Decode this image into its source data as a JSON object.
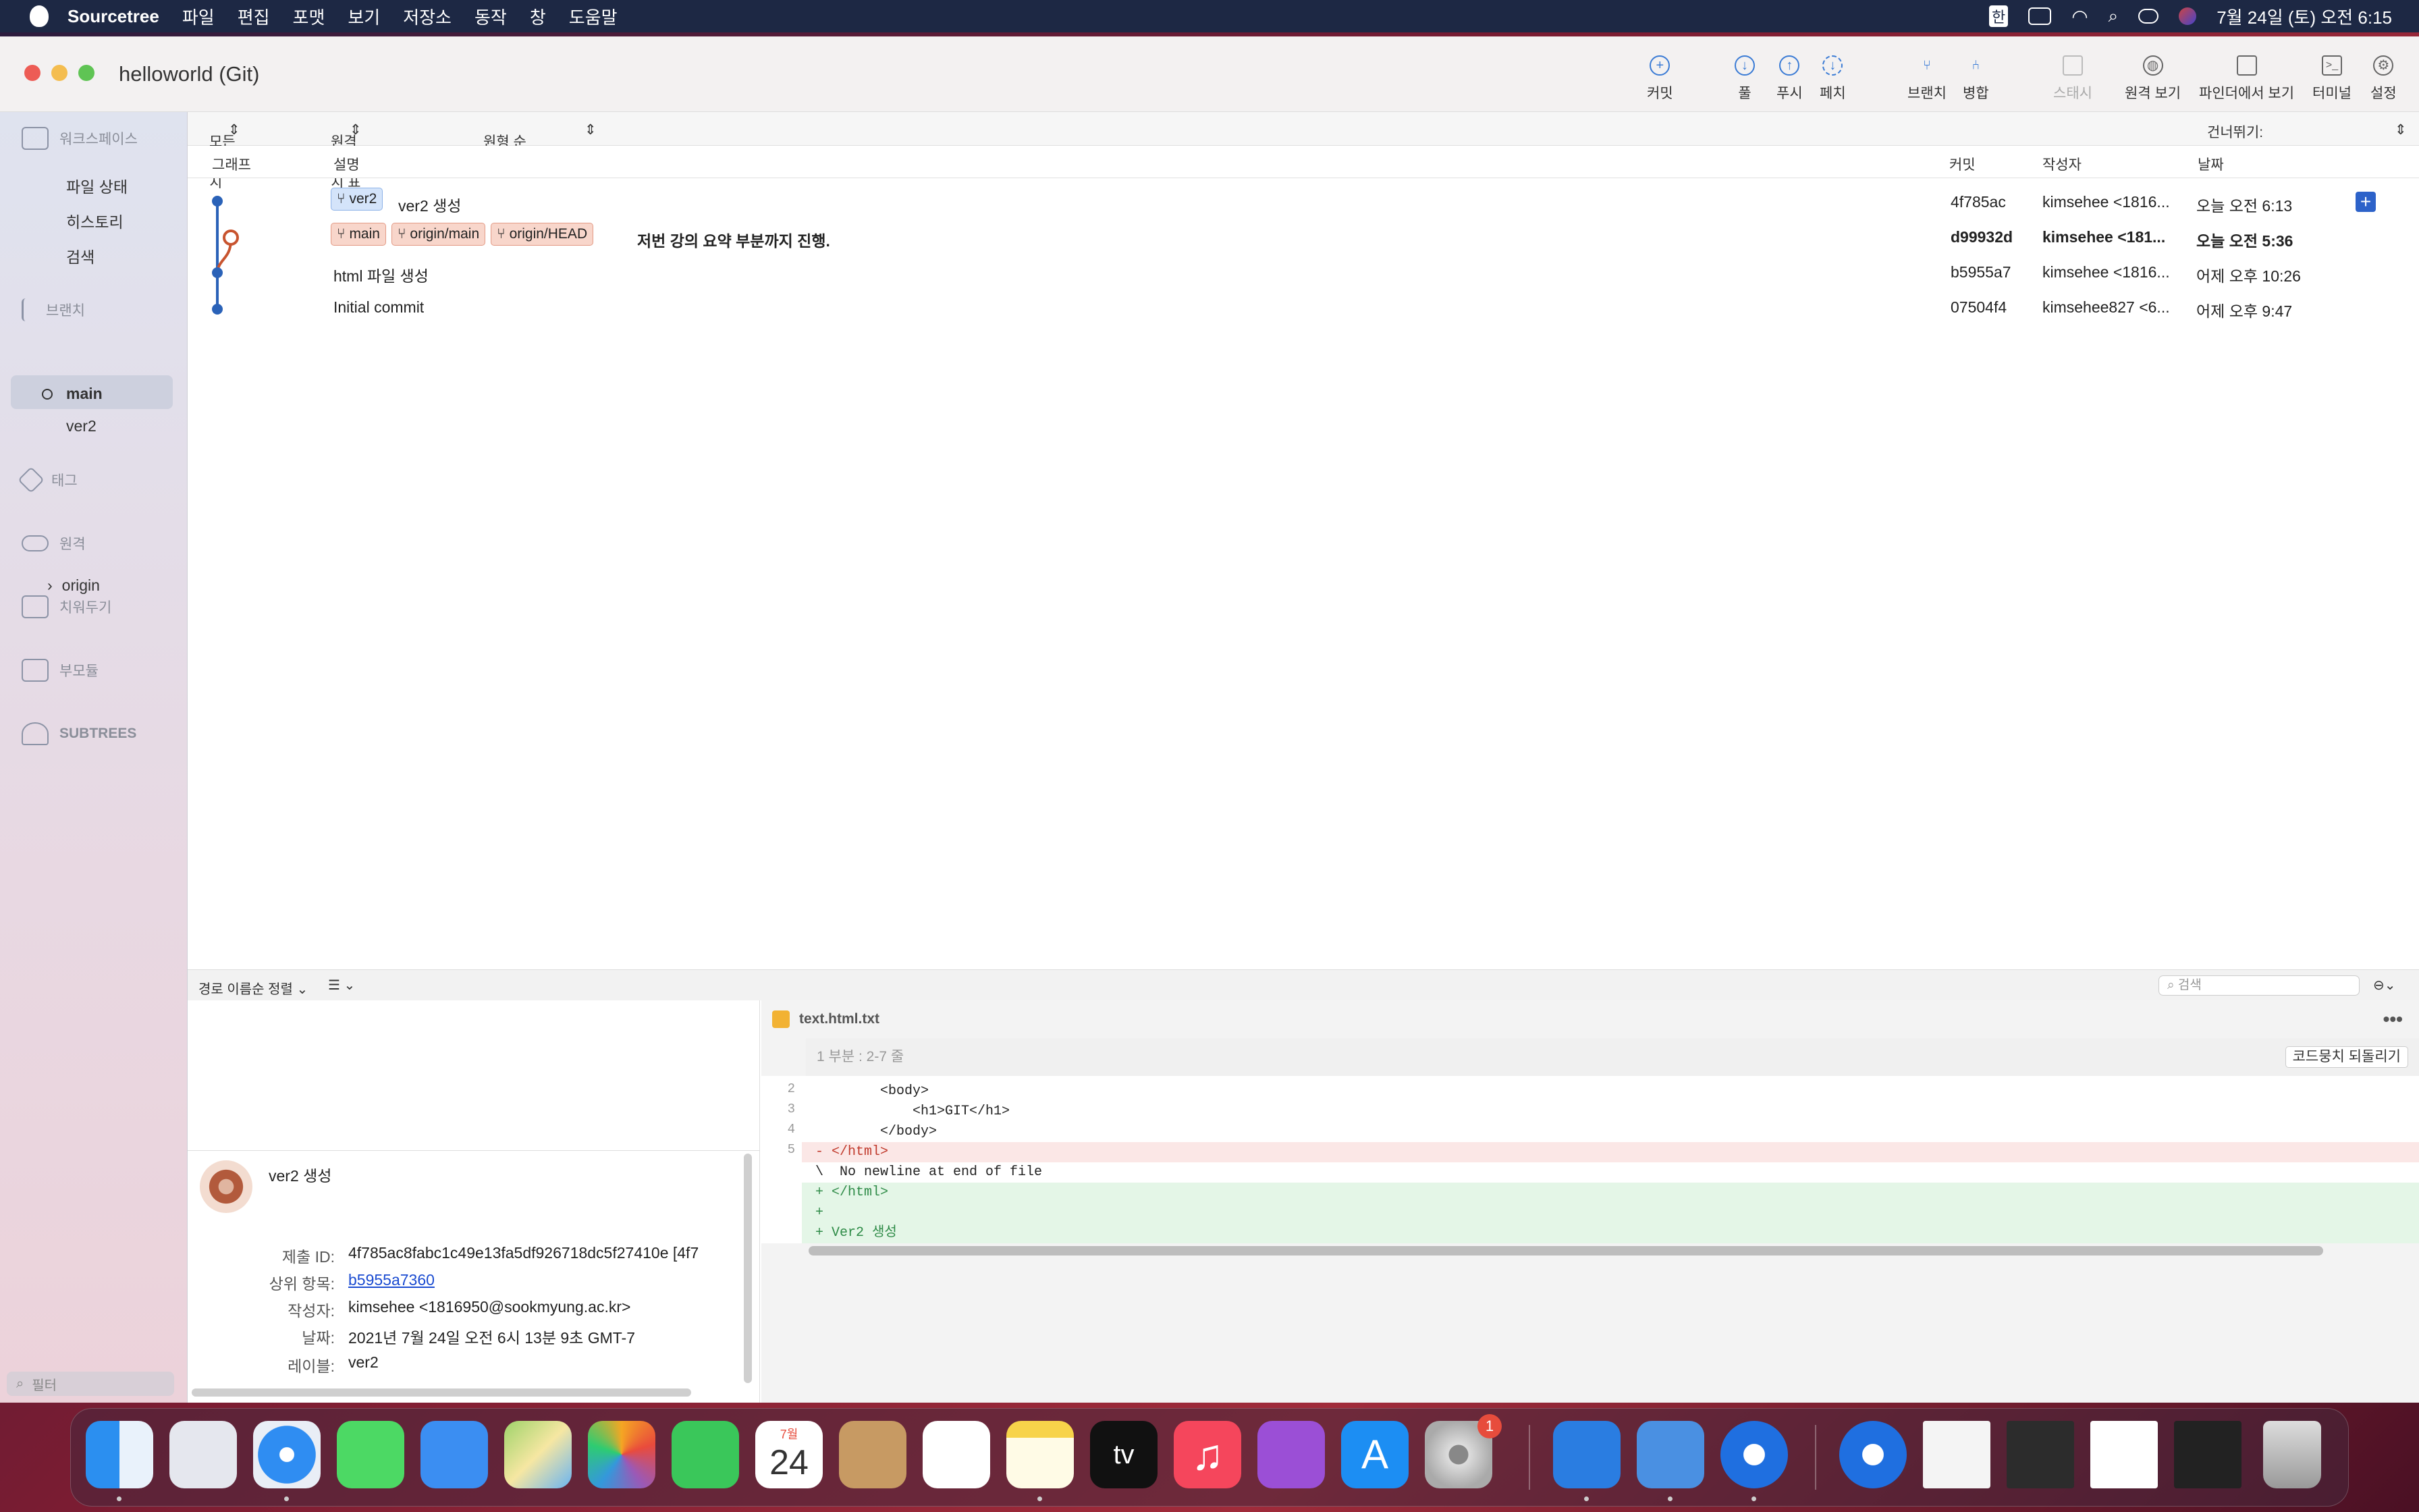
{
  "menubar": {
    "app": "Sourcetree",
    "items": [
      "파일",
      "편집",
      "포맷",
      "보기",
      "저장소",
      "동작",
      "창",
      "도움말"
    ],
    "input_indicator": "한",
    "clock": "7월 24일 (토) 오전 6:15"
  },
  "window": {
    "title": "helloworld (Git)"
  },
  "toolbar": {
    "commit": "커밋",
    "pull": "풀",
    "push": "푸시",
    "fetch": "페치",
    "branch": "브랜치",
    "merge": "병합",
    "stash": "스태시",
    "remote_view": "원격 보기",
    "finder_view": "파인더에서 보기",
    "terminal": "터미널",
    "settings": "설정"
  },
  "sidebar": {
    "workspace": "워크스페이스",
    "file_status": "파일 상태",
    "history": "히스토리",
    "search": "검색",
    "branches": "브랜치",
    "branch_main": "main",
    "branch_ver2": "ver2",
    "tags": "태그",
    "remotes": "원격",
    "remote_origin": "origin",
    "stashes": "치워두기",
    "submodules": "부모듈",
    "subtrees": "SUBTREES",
    "filter_placeholder": "필터"
  },
  "filterbar": {
    "all_branches": "모든 브랜치",
    "show_remote": "원격 브랜치 표시",
    "order": "원형 순",
    "skip": "건너뛰기:"
  },
  "columns": {
    "graph": "그래프",
    "description": "설명",
    "commit": "커밋",
    "author": "작성자",
    "date": "날짜"
  },
  "commits": [
    {
      "tags": [
        "ver2"
      ],
      "message": "ver2 생성",
      "hash": "4f785ac",
      "author": "kimsehee <1816...",
      "date": "오늘 오전 6:13"
    },
    {
      "tags": [
        "main",
        "origin/main",
        "origin/HEAD"
      ],
      "message": "저번 강의 요약 부분까지 진행.",
      "hash": "d99932d",
      "author": "kimsehee <181...",
      "date": "오늘 오전 5:36"
    },
    {
      "tags": [],
      "message": "html 파일 생성",
      "hash": "b5955a7",
      "author": "kimsehee <1816...",
      "date": "어제 오후 10:26"
    },
    {
      "tags": [],
      "message": "Initial commit",
      "hash": "07504f4",
      "author": "kimsehee827 <6...",
      "date": "어제 오후 9:47"
    }
  ],
  "bottom": {
    "sort": "경로 이름순 정렬",
    "search_placeholder": "검색",
    "file_name": "text.html.txt",
    "hunk_header": "1 부분 : 2-7 줄",
    "revert_hunk": "코드뭉치 되돌리기"
  },
  "diff": [
    {
      "num": "2",
      "text": "        <body>",
      "type": "ctx"
    },
    {
      "num": "3",
      "text": "            <h1>GIT</h1>",
      "type": "ctx"
    },
    {
      "num": "4",
      "text": "        </body>",
      "type": "ctx"
    },
    {
      "num": "5",
      "text": "- </html>",
      "type": "del"
    },
    {
      "num": "",
      "text": "\\  No newline at end of file",
      "type": "ctx"
    },
    {
      "num": "",
      "text": "+ </html>",
      "type": "add"
    },
    {
      "num": "",
      "text": "+",
      "type": "add"
    },
    {
      "num": "",
      "text": "+ Ver2 생성",
      "type": "add"
    }
  ],
  "details": {
    "subject": "ver2 생성",
    "id_label": "제출 ID:",
    "id_value": "4f785ac8fabc1c49e13fa5df926718dc5f27410e [4f7",
    "parent_label": "상위 항목:",
    "parent_value": "b5955a7360",
    "author_label": "작성자:",
    "author_value": "kimsehee <1816950@sookmyung.ac.kr>",
    "date_label": "날짜:",
    "date_value": "2021년 7월 24일 오전 6시 13분 9초 GMT-7",
    "labels_label": "레이블:",
    "labels_value": "ver2"
  },
  "dock": {
    "calendar_month": "7월",
    "calendar_day": "24",
    "tv_label": "tv",
    "settings_badge": "1"
  }
}
